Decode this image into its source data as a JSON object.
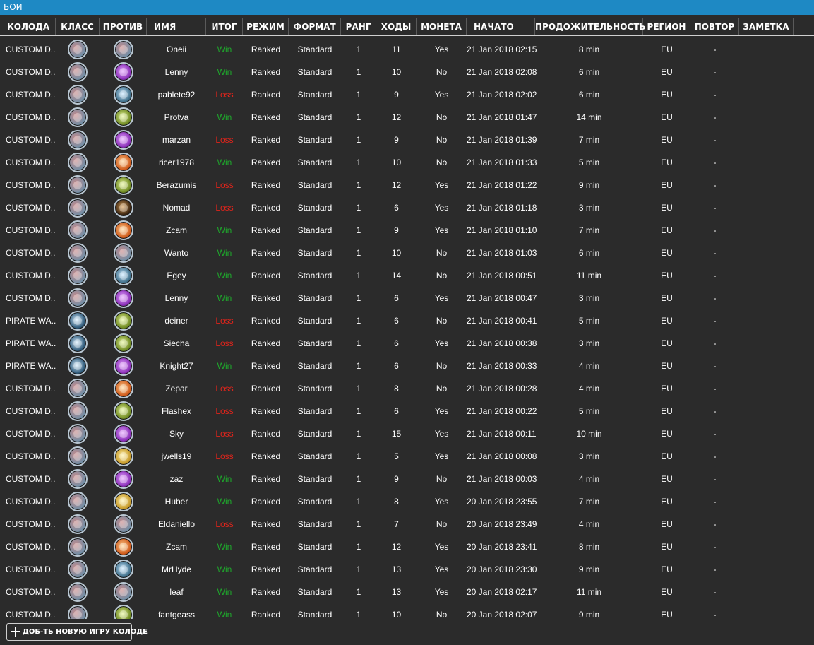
{
  "window": {
    "title": "БОИ"
  },
  "columns": {
    "deck": "КОЛОДА",
    "class": "КЛАСС",
    "against": "ПРОТИВ",
    "name": "ИМЯ",
    "result": "ИТОГ",
    "mode": "РЕЖИМ",
    "format": "ФОРМАТ",
    "rank": "РАНГ",
    "turns": "ХОДЫ",
    "coin": "МОНЕТА",
    "started": "НАЧАТО",
    "duration": "ПРОДОЖИТЕЛЬНОСТЬ",
    "region": "РЕГИОН",
    "replay": "ПОВТОР",
    "note": "ЗАМЕТКА"
  },
  "games": [
    {
      "deck": "CUSTOM D...",
      "class_icon": "warrior-icon",
      "opp_icon": "warrior-icon",
      "name": "Oneii",
      "result": "Win",
      "mode": "Ranked",
      "format": "Standard",
      "rank": "1",
      "turns": "11",
      "coin": "Yes",
      "started": "21 Jan 2018 02:15",
      "duration": "8 min",
      "region": "EU",
      "replay": "-"
    },
    {
      "deck": "CUSTOM D...",
      "class_icon": "warrior-icon",
      "opp_icon": "warlock-icon",
      "name": "Lenny",
      "result": "Win",
      "mode": "Ranked",
      "format": "Standard",
      "rank": "1",
      "turns": "10",
      "coin": "No",
      "started": "21 Jan 2018 02:08",
      "duration": "6 min",
      "region": "EU",
      "replay": "-"
    },
    {
      "deck": "CUSTOM D...",
      "class_icon": "warrior-icon",
      "opp_icon": "rogue-icon",
      "name": "pablete92",
      "result": "Loss",
      "mode": "Ranked",
      "format": "Standard",
      "rank": "1",
      "turns": "9",
      "coin": "Yes",
      "started": "21 Jan 2018 02:02",
      "duration": "6 min",
      "region": "EU",
      "replay": "-"
    },
    {
      "deck": "CUSTOM D...",
      "class_icon": "warrior-icon",
      "opp_icon": "druid-icon",
      "name": "Protva",
      "result": "Win",
      "mode": "Ranked",
      "format": "Standard",
      "rank": "1",
      "turns": "12",
      "coin": "No",
      "started": "21 Jan 2018 01:47",
      "duration": "14 min",
      "region": "EU",
      "replay": "-"
    },
    {
      "deck": "CUSTOM D...",
      "class_icon": "warrior-icon",
      "opp_icon": "warlock-icon",
      "name": "marzan",
      "result": "Loss",
      "mode": "Ranked",
      "format": "Standard",
      "rank": "1",
      "turns": "9",
      "coin": "No",
      "started": "21 Jan 2018 01:39",
      "duration": "7 min",
      "region": "EU",
      "replay": "-"
    },
    {
      "deck": "CUSTOM D...",
      "class_icon": "warrior-icon",
      "opp_icon": "mage-icon",
      "name": "ricer1978",
      "result": "Win",
      "mode": "Ranked",
      "format": "Standard",
      "rank": "1",
      "turns": "10",
      "coin": "No",
      "started": "21 Jan 2018 01:33",
      "duration": "5 min",
      "region": "EU",
      "replay": "-"
    },
    {
      "deck": "CUSTOM D...",
      "class_icon": "warrior-icon",
      "opp_icon": "druid-icon",
      "name": "Berazumis",
      "result": "Loss",
      "mode": "Ranked",
      "format": "Standard",
      "rank": "1",
      "turns": "12",
      "coin": "Yes",
      "started": "21 Jan 2018 01:22",
      "duration": "9 min",
      "region": "EU",
      "replay": "-"
    },
    {
      "deck": "CUSTOM D...",
      "class_icon": "warrior-icon",
      "opp_icon": "hunter-icon",
      "name": "Nomad",
      "result": "Loss",
      "mode": "Ranked",
      "format": "Standard",
      "rank": "1",
      "turns": "6",
      "coin": "Yes",
      "started": "21 Jan 2018 01:18",
      "duration": "3 min",
      "region": "EU",
      "replay": "-"
    },
    {
      "deck": "CUSTOM D...",
      "class_icon": "warrior-icon",
      "opp_icon": "mage-icon",
      "name": "Zcam",
      "result": "Win",
      "mode": "Ranked",
      "format": "Standard",
      "rank": "1",
      "turns": "9",
      "coin": "Yes",
      "started": "21 Jan 2018 01:10",
      "duration": "7 min",
      "region": "EU",
      "replay": "-"
    },
    {
      "deck": "CUSTOM D...",
      "class_icon": "warrior-icon",
      "opp_icon": "warrior-icon",
      "name": "Wanto",
      "result": "Win",
      "mode": "Ranked",
      "format": "Standard",
      "rank": "1",
      "turns": "10",
      "coin": "No",
      "started": "21 Jan 2018 01:03",
      "duration": "6 min",
      "region": "EU",
      "replay": "-"
    },
    {
      "deck": "CUSTOM D...",
      "class_icon": "warrior-icon",
      "opp_icon": "rogue-icon",
      "name": "Egey",
      "result": "Win",
      "mode": "Ranked",
      "format": "Standard",
      "rank": "1",
      "turns": "14",
      "coin": "No",
      "started": "21 Jan 2018 00:51",
      "duration": "11 min",
      "region": "EU",
      "replay": "-"
    },
    {
      "deck": "CUSTOM D...",
      "class_icon": "warrior-icon",
      "opp_icon": "warlock-icon",
      "name": "Lenny",
      "result": "Win",
      "mode": "Ranked",
      "format": "Standard",
      "rank": "1",
      "turns": "6",
      "coin": "Yes",
      "started": "21 Jan 2018 00:47",
      "duration": "3 min",
      "region": "EU",
      "replay": "-"
    },
    {
      "deck": "PIRATE WA...",
      "class_icon": "pirate-warrior-icon",
      "opp_icon": "druid-icon",
      "name": "deiner",
      "result": "Loss",
      "mode": "Ranked",
      "format": "Standard",
      "rank": "1",
      "turns": "6",
      "coin": "No",
      "started": "21 Jan 2018 00:41",
      "duration": "5 min",
      "region": "EU",
      "replay": "-"
    },
    {
      "deck": "PIRATE WA...",
      "class_icon": "pirate-warrior-icon",
      "opp_icon": "druid-icon",
      "name": "Siecha",
      "result": "Loss",
      "mode": "Ranked",
      "format": "Standard",
      "rank": "1",
      "turns": "6",
      "coin": "Yes",
      "started": "21 Jan 2018 00:38",
      "duration": "3 min",
      "region": "EU",
      "replay": "-"
    },
    {
      "deck": "PIRATE WA...",
      "class_icon": "pirate-warrior-icon",
      "opp_icon": "warlock-icon",
      "name": "Knight27",
      "result": "Win",
      "mode": "Ranked",
      "format": "Standard",
      "rank": "1",
      "turns": "6",
      "coin": "No",
      "started": "21 Jan 2018 00:33",
      "duration": "4 min",
      "region": "EU",
      "replay": "-"
    },
    {
      "deck": "CUSTOM D...",
      "class_icon": "warrior-icon",
      "opp_icon": "mage-icon",
      "name": "Zepar",
      "result": "Loss",
      "mode": "Ranked",
      "format": "Standard",
      "rank": "1",
      "turns": "8",
      "coin": "No",
      "started": "21 Jan 2018 00:28",
      "duration": "4 min",
      "region": "EU",
      "replay": "-"
    },
    {
      "deck": "CUSTOM D...",
      "class_icon": "warrior-icon",
      "opp_icon": "druid-icon",
      "name": "Flashex",
      "result": "Loss",
      "mode": "Ranked",
      "format": "Standard",
      "rank": "1",
      "turns": "6",
      "coin": "Yes",
      "started": "21 Jan 2018 00:22",
      "duration": "5 min",
      "region": "EU",
      "replay": "-"
    },
    {
      "deck": "CUSTOM D...",
      "class_icon": "warrior-icon",
      "opp_icon": "warlock-icon",
      "name": "Sky",
      "result": "Loss",
      "mode": "Ranked",
      "format": "Standard",
      "rank": "1",
      "turns": "15",
      "coin": "Yes",
      "started": "21 Jan 2018 00:11",
      "duration": "10 min",
      "region": "EU",
      "replay": "-"
    },
    {
      "deck": "CUSTOM D...",
      "class_icon": "warrior-icon",
      "opp_icon": "paladin-icon",
      "name": "jwells19",
      "result": "Loss",
      "mode": "Ranked",
      "format": "Standard",
      "rank": "1",
      "turns": "5",
      "coin": "Yes",
      "started": "21 Jan 2018 00:08",
      "duration": "3 min",
      "region": "EU",
      "replay": "-"
    },
    {
      "deck": "CUSTOM D...",
      "class_icon": "warrior-icon",
      "opp_icon": "warlock-icon",
      "name": "zaz",
      "result": "Win",
      "mode": "Ranked",
      "format": "Standard",
      "rank": "1",
      "turns": "9",
      "coin": "No",
      "started": "21 Jan 2018 00:03",
      "duration": "4 min",
      "region": "EU",
      "replay": "-"
    },
    {
      "deck": "CUSTOM D...",
      "class_icon": "warrior-icon",
      "opp_icon": "paladin-icon",
      "name": "Huber",
      "result": "Win",
      "mode": "Ranked",
      "format": "Standard",
      "rank": "1",
      "turns": "8",
      "coin": "Yes",
      "started": "20 Jan 2018 23:55",
      "duration": "7 min",
      "region": "EU",
      "replay": "-"
    },
    {
      "deck": "CUSTOM D...",
      "class_icon": "warrior-icon",
      "opp_icon": "warrior-icon",
      "name": "Eldaniello",
      "result": "Loss",
      "mode": "Ranked",
      "format": "Standard",
      "rank": "1",
      "turns": "7",
      "coin": "No",
      "started": "20 Jan 2018 23:49",
      "duration": "4 min",
      "region": "EU",
      "replay": "-"
    },
    {
      "deck": "CUSTOM D...",
      "class_icon": "warrior-icon",
      "opp_icon": "mage-icon",
      "name": "Zcam",
      "result": "Win",
      "mode": "Ranked",
      "format": "Standard",
      "rank": "1",
      "turns": "12",
      "coin": "Yes",
      "started": "20 Jan 2018 23:41",
      "duration": "8 min",
      "region": "EU",
      "replay": "-"
    },
    {
      "deck": "CUSTOM D...",
      "class_icon": "warrior-icon",
      "opp_icon": "rogue-icon",
      "name": "MrHyde",
      "result": "Win",
      "mode": "Ranked",
      "format": "Standard",
      "rank": "1",
      "turns": "13",
      "coin": "Yes",
      "started": "20 Jan 2018 23:30",
      "duration": "9 min",
      "region": "EU",
      "replay": "-"
    },
    {
      "deck": "CUSTOM D...",
      "class_icon": "warrior-icon",
      "opp_icon": "warrior-icon",
      "name": "leaf",
      "result": "Win",
      "mode": "Ranked",
      "format": "Standard",
      "rank": "1",
      "turns": "13",
      "coin": "Yes",
      "started": "20 Jan 2018 02:17",
      "duration": "11 min",
      "region": "EU",
      "replay": "-"
    },
    {
      "deck": "CUSTOM D...",
      "class_icon": "warrior-icon",
      "opp_icon": "druid-icon",
      "name": "fantgeass",
      "result": "Win",
      "mode": "Ranked",
      "format": "Standard",
      "rank": "1",
      "turns": "10",
      "coin": "No",
      "started": "20 Jan 2018 02:07",
      "duration": "9 min",
      "region": "EU",
      "replay": "-"
    }
  ],
  "actions": {
    "add_game_label": "ДОБ-ТЬ НОВУЮ ИГРУ КОЛОДЕ"
  },
  "colors": {
    "titlebar": "#1e89c4",
    "win": "#1fa62c",
    "loss": "#e0241b",
    "background": "#2b2b2b"
  }
}
